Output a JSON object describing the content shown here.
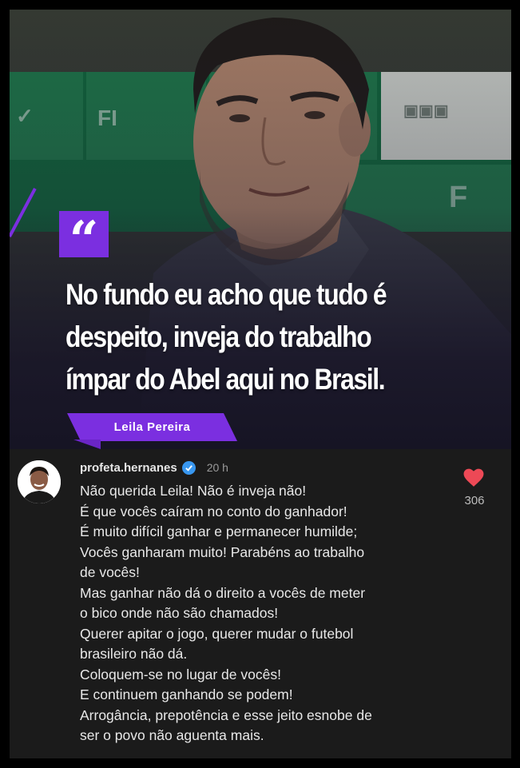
{
  "quote": {
    "mark": "“",
    "lines": [
      "No fundo eu acho que tudo é",
      "despeito, inveja do trabalho",
      "ímpar do Abel aqui no Brasil."
    ],
    "author": "Leila Pereira"
  },
  "comment": {
    "username": "profeta.hernanes",
    "verified": true,
    "time": "20 h",
    "likes": "306",
    "lines": [
      "Não querida Leila! Não é inveja não!",
      "É que vocês caíram no conto do ganhador!",
      "É muito difícil ganhar e permanecer humilde;",
      "Vocês ganharam muito! Parabéns ao trabalho",
      "de vocês!",
      "Mas ganhar não dá o direito a vocês de meter",
      "o bico onde não são chamados!",
      "Querer apitar o jogo, querer mudar o futebol",
      "brasileiro não dá.",
      "Coloquem-se no lugar de vocês!",
      "E continuem ganhando se podem!",
      "Arrogância, prepotência e esse jeito esnobe de",
      "ser o povo não aguenta mais."
    ]
  },
  "colors": {
    "accent_purple": "#7b2fe0",
    "heart_red": "#ed4956",
    "verified_blue": "#3897f0"
  }
}
